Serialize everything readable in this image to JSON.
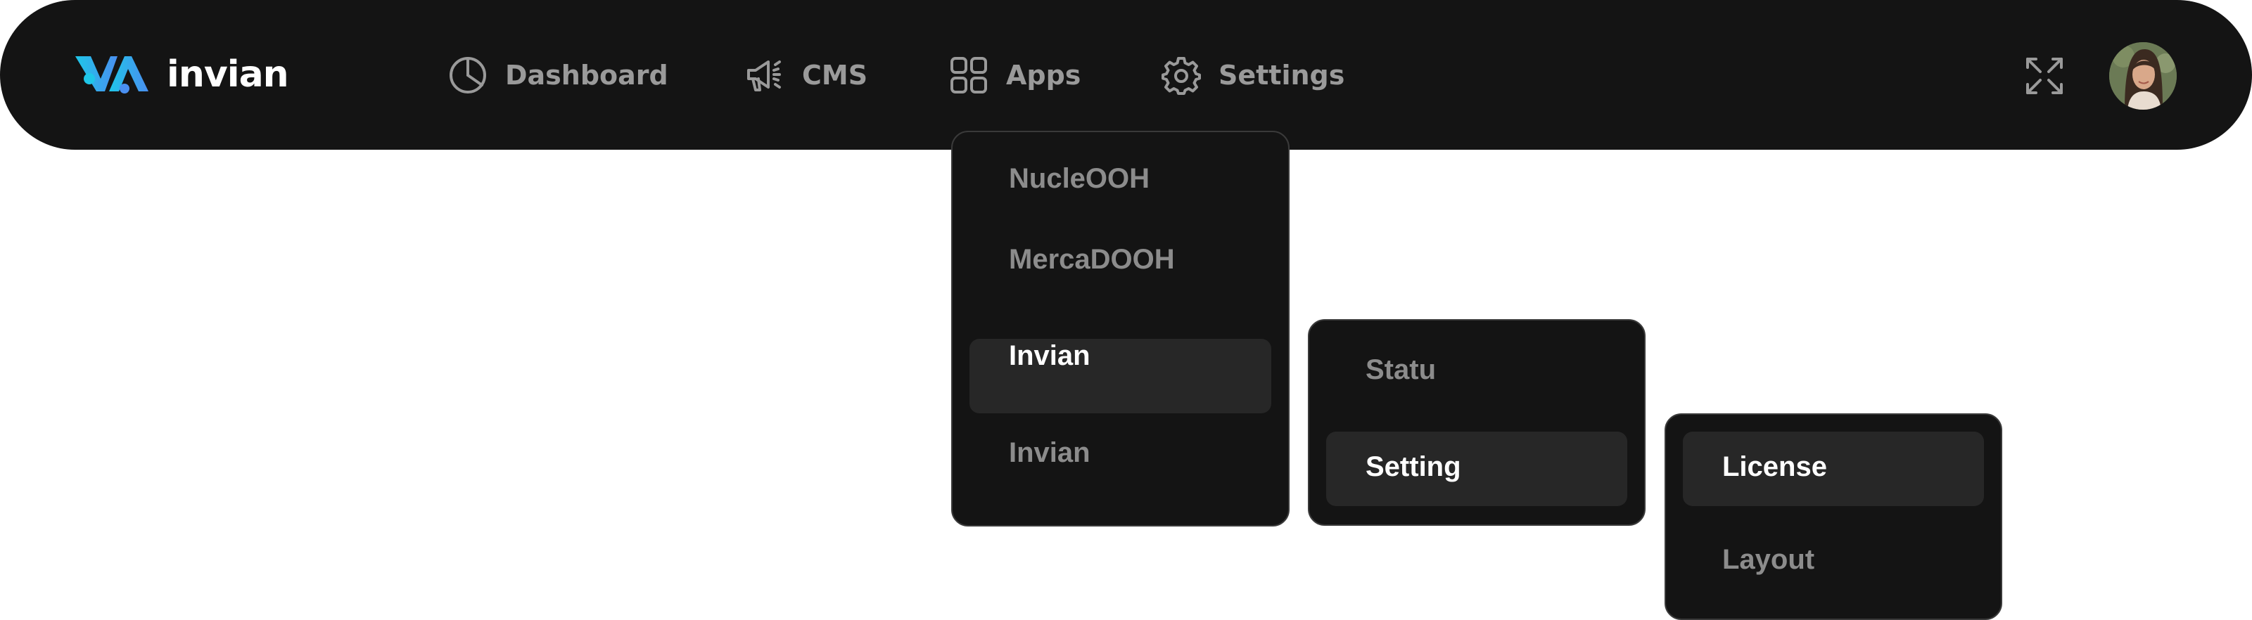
{
  "brand": {
    "name": "invian",
    "logo_colors": [
      "#1fc6e8",
      "#4a8ff0"
    ]
  },
  "nav": {
    "items": [
      {
        "label": "Dashboard",
        "icon": "pie-chart-icon"
      },
      {
        "label": "CMS",
        "icon": "megaphone-icon"
      },
      {
        "label": "Apps",
        "icon": "apps-grid-icon"
      },
      {
        "label": "Settings",
        "icon": "gear-icon"
      }
    ],
    "expand_icon": "expand-icon",
    "avatar": "user-avatar"
  },
  "apps_menu": {
    "items": [
      {
        "label": "NucleOOH",
        "active": false
      },
      {
        "label": "MercaDOOH",
        "active": false
      },
      {
        "label": "Invian",
        "active": true
      },
      {
        "label": "Invian",
        "active": false
      }
    ]
  },
  "sub_menu": {
    "items": [
      {
        "label": "Statu",
        "active": false
      },
      {
        "label": "Setting",
        "active": true
      }
    ]
  },
  "sub_sub_menu": {
    "items": [
      {
        "label": "License",
        "active": true
      },
      {
        "label": "Layout",
        "active": false
      }
    ]
  },
  "colors": {
    "navbar_bg": "#141414",
    "nav_text": "#9a9a9a",
    "active_item_bg": "#272727",
    "active_text": "#ffffff"
  }
}
